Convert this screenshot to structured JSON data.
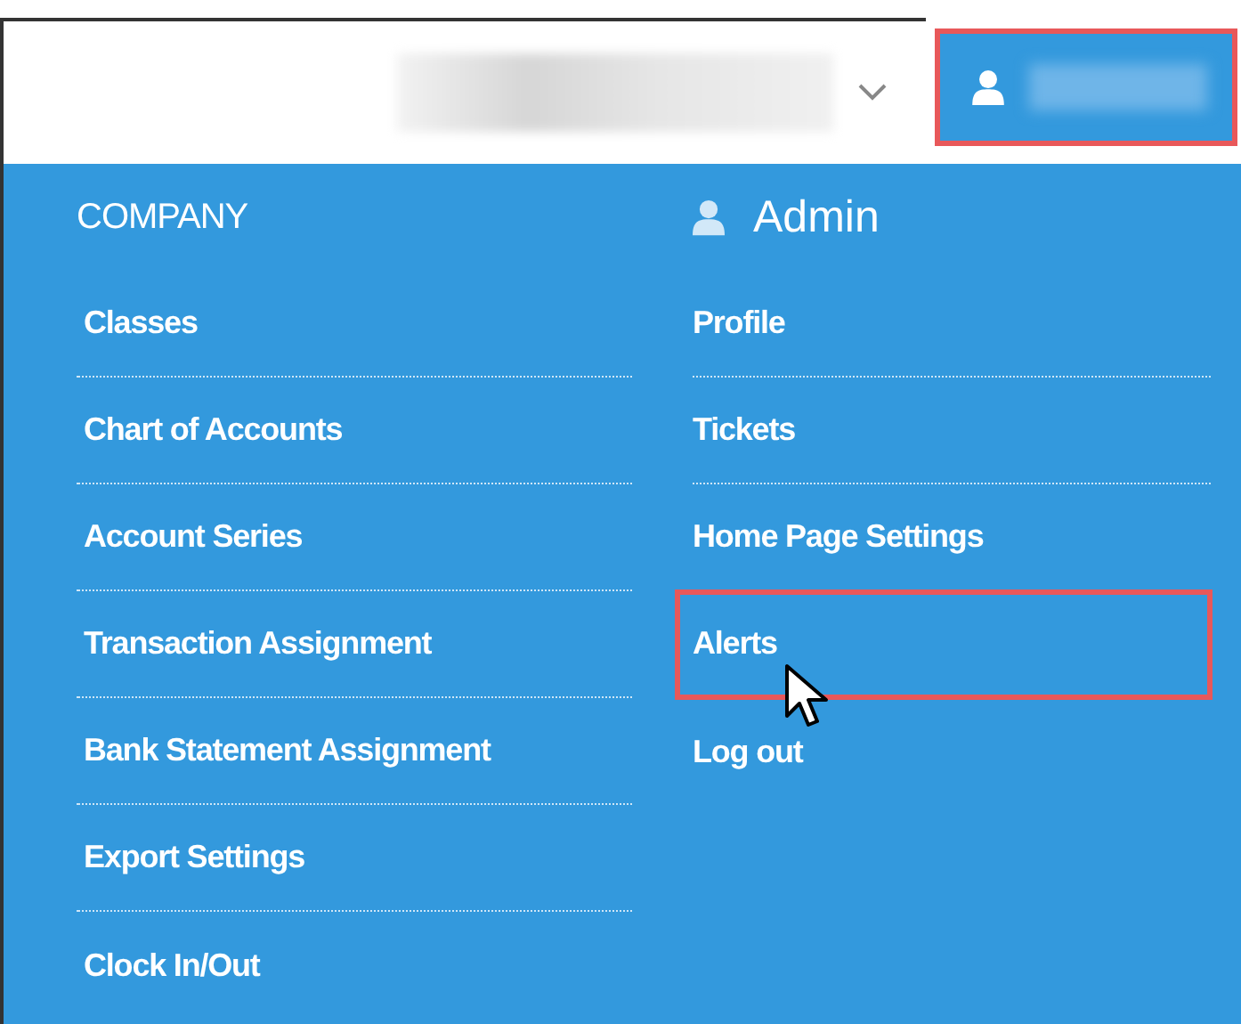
{
  "header": {
    "user_menu": {
      "highlighted": true
    }
  },
  "menu": {
    "columns": [
      {
        "heading": "COMPANY",
        "kind": "section",
        "items": [
          {
            "label": "Classes",
            "highlighted": false
          },
          {
            "label": "Chart of Accounts",
            "highlighted": false
          },
          {
            "label": "Account Series",
            "highlighted": false
          },
          {
            "label": "Transaction Assignment",
            "highlighted": false
          },
          {
            "label": "Bank Statement Assignment",
            "highlighted": false
          },
          {
            "label": "Export Settings",
            "highlighted": false
          },
          {
            "label": "Clock In/Out",
            "highlighted": false
          }
        ]
      },
      {
        "heading": "Admin",
        "kind": "user",
        "items": [
          {
            "label": "Profile",
            "highlighted": false
          },
          {
            "label": "Tickets",
            "highlighted": false
          },
          {
            "label": "Home Page Settings",
            "highlighted": false
          },
          {
            "label": "Alerts",
            "highlighted": true
          },
          {
            "label": "Log out",
            "highlighted": false
          }
        ]
      }
    ]
  }
}
